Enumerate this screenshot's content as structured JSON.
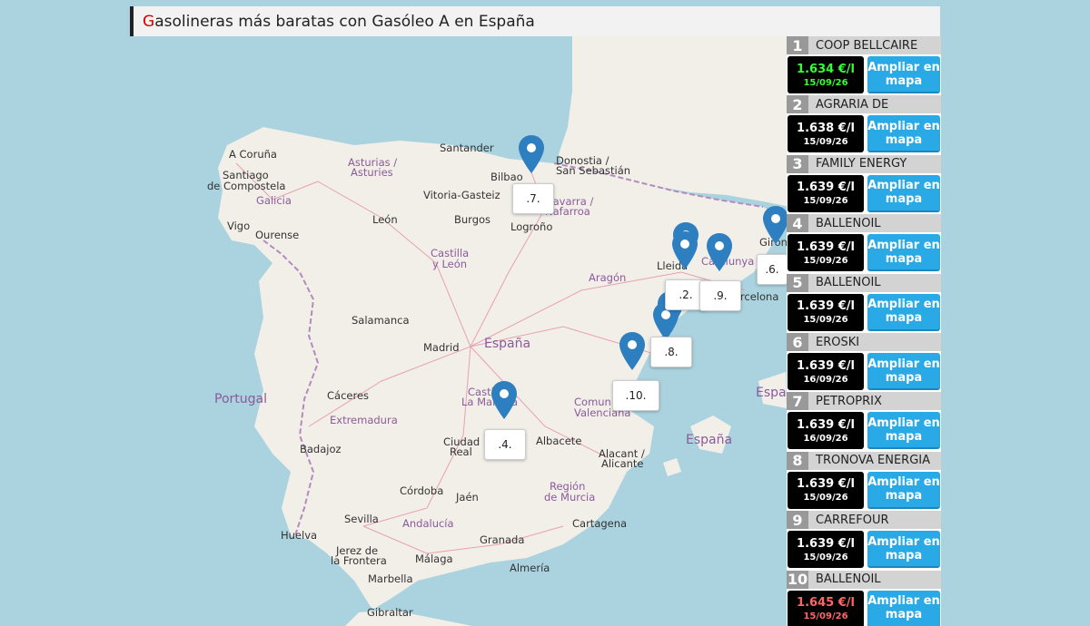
{
  "title": {
    "first_letter": "G",
    "rest": "asolineras más baratas con Gasóleo A en España"
  },
  "colors": {
    "price_cheap": "#33ff33",
    "price_normal": "#ffffff",
    "price_expensive": "#ff6666",
    "button": "#29a9e6"
  },
  "map": {
    "cities": [
      "A Coruña",
      "Santiago",
      "de Compostela",
      "Vigo",
      "Ourense",
      "Santander",
      "Bilbao",
      "Donostia /",
      "San Sebastián",
      "Vitoria-Gasteiz",
      "León",
      "Burgos",
      "Logroño",
      "Lleida",
      "Girona",
      "Barcelona",
      "Salamanca",
      "Madrid",
      "Cáceres",
      "Badajoz",
      "Ciudad",
      "Real",
      "Albacete",
      "Alacant /",
      "Alicante",
      "Córdoba",
      "Jaén",
      "Sevilla",
      "Huelva",
      "Granada",
      "Jerez de",
      "la Frontera",
      "Málaga",
      "Marbella",
      "Cartagena",
      "Almería",
      "Gibraltar"
    ],
    "regions": [
      "Galicia",
      "Asturias /",
      "Asturies",
      "Castilla",
      "y León",
      "Navarra /",
      "Nafarroa",
      "Aragón",
      "Catalunya",
      "Extremadura",
      "Castilla-",
      "La Mancha",
      "Comunitat",
      "Valenciana",
      "Región",
      "de Murcia",
      "Andalucía"
    ],
    "countries": [
      "Portugal",
      "España",
      "España",
      "España"
    ],
    "markers": [
      ".7.",
      ".2.",
      ".9.",
      ".6.",
      ".8.",
      ".10.",
      ".4."
    ]
  },
  "stations": [
    {
      "rank": "1",
      "name": "COOP BELLCAIRE",
      "price": "1.634 €/l",
      "date": "15/09/26",
      "tier": "cheap"
    },
    {
      "rank": "2",
      "name": "AGRARIA DE",
      "price": "1.638 €/l",
      "date": "15/09/26",
      "tier": "normal"
    },
    {
      "rank": "3",
      "name": "FAMILY ENERGY",
      "price": "1.639 €/l",
      "date": "15/09/26",
      "tier": "normal"
    },
    {
      "rank": "4",
      "name": "BALLENOIL",
      "price": "1.639 €/l",
      "date": "15/09/26",
      "tier": "normal"
    },
    {
      "rank": "5",
      "name": "BALLENOIL",
      "price": "1.639 €/l",
      "date": "15/09/26",
      "tier": "normal"
    },
    {
      "rank": "6",
      "name": "EROSKI",
      "price": "1.639 €/l",
      "date": "16/09/26",
      "tier": "normal"
    },
    {
      "rank": "7",
      "name": "PETROPRIX",
      "price": "1.639 €/l",
      "date": "16/09/26",
      "tier": "normal"
    },
    {
      "rank": "8",
      "name": "TRONOVA ENERGIA",
      "price": "1.639 €/l",
      "date": "15/09/26",
      "tier": "normal"
    },
    {
      "rank": "9",
      "name": "CARREFOUR",
      "price": "1.639 €/l",
      "date": "15/09/26",
      "tier": "normal"
    },
    {
      "rank": "10",
      "name": "BALLENOIL",
      "price": "1.645 €/l",
      "date": "15/09/26",
      "tier": "expensive"
    }
  ],
  "button_label_line1": "Ampliar en",
  "button_label_line2": "mapa"
}
